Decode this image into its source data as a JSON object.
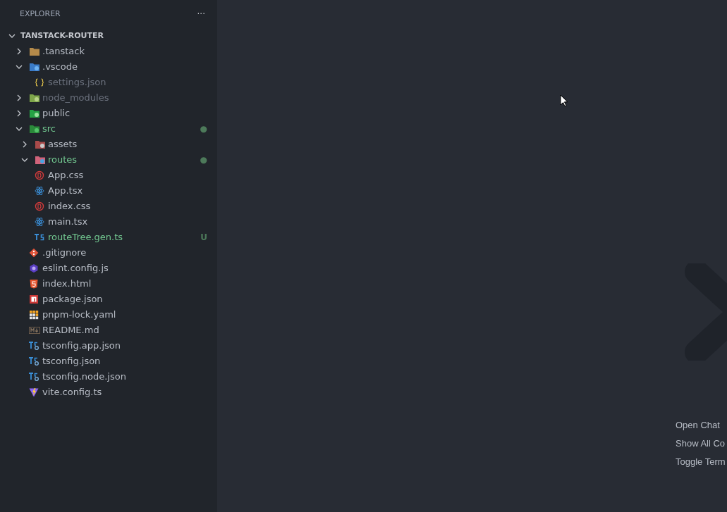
{
  "explorer": {
    "title": "EXPLORER",
    "more": "···"
  },
  "project": {
    "name": "TANSTACK-ROUTER",
    "expanded": true,
    "children": [
      {
        "name": ".tanstack",
        "kind": "folder",
        "expanded": false
      },
      {
        "name": ".vscode",
        "kind": "vscodefolder",
        "expanded": true,
        "children": [
          {
            "name": "settings.json",
            "kind": "json",
            "ignored": true
          }
        ]
      },
      {
        "name": "node_modules",
        "kind": "nodefolder",
        "expanded": false,
        "ignored": true
      },
      {
        "name": "public",
        "kind": "publicfolder",
        "expanded": false
      },
      {
        "name": "src",
        "kind": "srcfolder",
        "expanded": true,
        "changed": true,
        "badge": "●",
        "children": [
          {
            "name": "assets",
            "kind": "assetsfolder",
            "expanded": false
          },
          {
            "name": "routes",
            "kind": "routesfolder",
            "expanded": true,
            "changed": true,
            "badge": "●"
          },
          {
            "name": "App.css",
            "kind": "css"
          },
          {
            "name": "App.tsx",
            "kind": "react"
          },
          {
            "name": "index.css",
            "kind": "css"
          },
          {
            "name": "main.tsx",
            "kind": "react"
          },
          {
            "name": "routeTree.gen.ts",
            "kind": "ts",
            "changed": true,
            "badge": "U"
          }
        ]
      },
      {
        "name": ".gitignore",
        "kind": "git"
      },
      {
        "name": "eslint.config.js",
        "kind": "eslint"
      },
      {
        "name": "index.html",
        "kind": "html"
      },
      {
        "name": "package.json",
        "kind": "npm"
      },
      {
        "name": "pnpm-lock.yaml",
        "kind": "pnpm"
      },
      {
        "name": "README.md",
        "kind": "markdown"
      },
      {
        "name": "tsconfig.app.json",
        "kind": "tsconfig"
      },
      {
        "name": "tsconfig.json",
        "kind": "tsconfig"
      },
      {
        "name": "tsconfig.node.json",
        "kind": "tsconfig"
      },
      {
        "name": "vite.config.ts",
        "kind": "vite"
      }
    ]
  },
  "editor": {
    "shortcuts": [
      "Open Chat",
      "Show All Co",
      "Toggle Term"
    ]
  }
}
